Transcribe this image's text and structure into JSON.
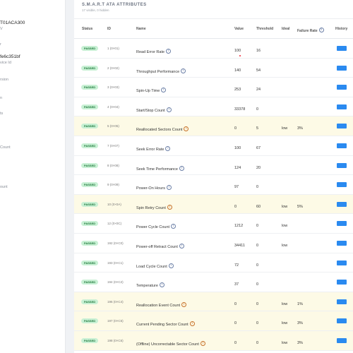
{
  "sidebar": {
    "lines": [
      "T01ACA300",
      "V",
      "r",
      "fe6c351bf",
      "vice Id",
      "rsion",
      "n",
      "ts",
      "Count",
      "ount"
    ]
  },
  "card": {
    "title": "S.M.A.R.T ATA ATTRIBUTES",
    "subtitle": "17 visible, 0 hidden"
  },
  "columns": {
    "status": "Status",
    "id": "ID",
    "name": "Name",
    "value": "Value",
    "threshold": "Threshold",
    "ideal": "Ideal",
    "failure_rate": "Failure Rate",
    "history": "History"
  },
  "rows": [
    {
      "status": "PASSED",
      "id": "1 (0×01)",
      "name": "Read Error Rate",
      "value": "100",
      "threshold": "16",
      "ideal": "",
      "failure_rate": "",
      "warn": false
    },
    {
      "status": "PASSED",
      "id": "2 (0×02)",
      "name": "Throughput Performance",
      "value": "140",
      "threshold": "54",
      "ideal": "",
      "failure_rate": "",
      "warn": false
    },
    {
      "status": "PASSED",
      "id": "3 (0×03)",
      "name": "Spin-Up Time",
      "value": "253",
      "threshold": "24",
      "ideal": "",
      "failure_rate": "",
      "warn": false
    },
    {
      "status": "PASSED",
      "id": "4 (0×04)",
      "name": "Start/Stop Count",
      "value": "33378",
      "threshold": "0",
      "ideal": "",
      "failure_rate": "",
      "warn": false
    },
    {
      "status": "PASSED",
      "id": "5 (0×05)",
      "name": "Reallocated Sectors Count",
      "value": "0",
      "threshold": "5",
      "ideal": "low",
      "failure_rate": "3%",
      "warn": true
    },
    {
      "status": "PASSED",
      "id": "7 (0×07)",
      "name": "Seek Error Rate",
      "value": "100",
      "threshold": "67",
      "ideal": "",
      "failure_rate": "",
      "warn": false
    },
    {
      "status": "PASSED",
      "id": "8 (0×08)",
      "name": "Seek Time Performance",
      "value": "124",
      "threshold": "20",
      "ideal": "",
      "failure_rate": "",
      "warn": false
    },
    {
      "status": "PASSED",
      "id": "9 (0×09)",
      "name": "Power-On Hours",
      "value": "97",
      "threshold": "0",
      "ideal": "",
      "failure_rate": "",
      "warn": false
    },
    {
      "status": "PASSED",
      "id": "10 (0×0A)",
      "name": "Spin Retry Count",
      "value": "0",
      "threshold": "60",
      "ideal": "low",
      "failure_rate": "5%",
      "warn": true
    },
    {
      "status": "PASSED",
      "id": "12 (0×0C)",
      "name": "Power Cycle Count",
      "value": "1212",
      "threshold": "0",
      "ideal": "low",
      "failure_rate": "",
      "warn": false
    },
    {
      "status": "PASSED",
      "id": "192 (0×C0)",
      "name": "Power-off Retract Count",
      "value": "34411",
      "threshold": "0",
      "ideal": "low",
      "failure_rate": "",
      "warn": false
    },
    {
      "status": "PASSED",
      "id": "193 (0×C1)",
      "name": "Load Cycle Count",
      "value": "72",
      "threshold": "0",
      "ideal": "",
      "failure_rate": "",
      "warn": false
    },
    {
      "status": "PASSED",
      "id": "194 (0×C2)",
      "name": "Temperature",
      "value": "37",
      "threshold": "0",
      "ideal": "",
      "failure_rate": "",
      "warn": false
    },
    {
      "status": "PASSED",
      "id": "196 (0×C4)",
      "name": "Reallocation Event Count",
      "value": "0",
      "threshold": "0",
      "ideal": "low",
      "failure_rate": "1%",
      "warn": true
    },
    {
      "status": "PASSED",
      "id": "197 (0×C5)",
      "name": "Current Pending Sector Count",
      "value": "0",
      "threshold": "0",
      "ideal": "low",
      "failure_rate": "3%",
      "warn": true
    },
    {
      "status": "PASSED",
      "id": "198 (0×C6)",
      "name": "(Offline) Uncorrectable Sector Count",
      "value": "0",
      "threshold": "0",
      "ideal": "low",
      "failure_rate": "3%",
      "warn": true
    }
  ],
  "colors": {
    "passed_bg": "#c8f0d4",
    "passed_text": "#1f7a3c",
    "warn_row": "#fdfae6",
    "history_bar": "#2a8af0",
    "info_icon": "#6b7fa6",
    "warn_icon": "#c7722a"
  }
}
